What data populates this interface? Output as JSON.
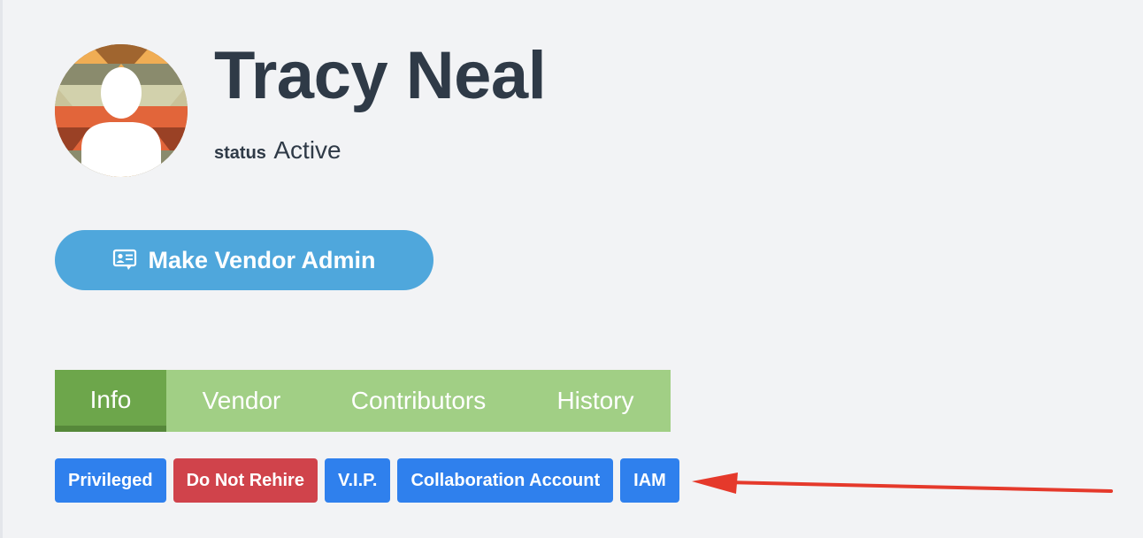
{
  "profile": {
    "name": "Tracy Neal",
    "status_label": "status",
    "status_value": "Active"
  },
  "actions": {
    "make_vendor_admin": {
      "label": "Make Vendor Admin",
      "icon": "id-card-chat-icon"
    }
  },
  "tabs": [
    {
      "label": "Info",
      "active": true
    },
    {
      "label": "Vendor",
      "active": false
    },
    {
      "label": "Contributors",
      "active": false
    },
    {
      "label": "History",
      "active": false
    }
  ],
  "badges": [
    {
      "label": "Privileged",
      "color": "#2f80ed"
    },
    {
      "label": "Do Not Rehire",
      "color": "#d0434b"
    },
    {
      "label": "V.I.P.",
      "color": "#2f80ed"
    },
    {
      "label": "Collaboration Account",
      "color": "#2f80ed"
    },
    {
      "label": "IAM",
      "color": "#2f80ed"
    }
  ],
  "colors": {
    "background": "#f2f3f5",
    "primary_button": "#4fa7dc",
    "tab_bar": "#a1cf85",
    "tab_active": "#6da64b",
    "annotation_arrow": "#e5392b",
    "heading_text": "#2f3a47"
  }
}
